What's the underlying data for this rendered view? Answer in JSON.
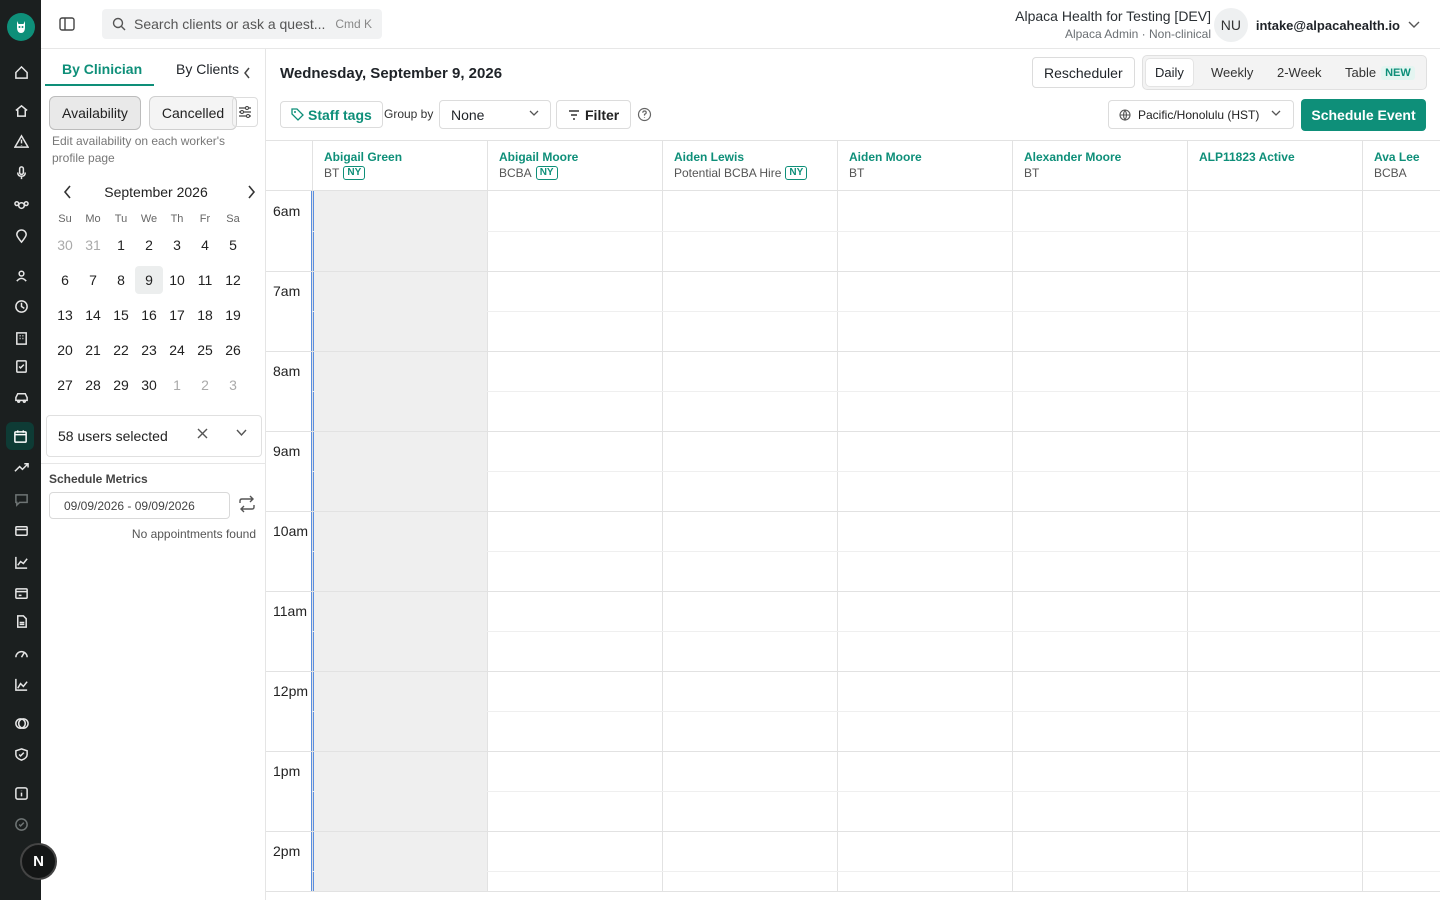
{
  "search": {
    "placeholder": "Search clients or ask a quest...",
    "shortcut": "Cmd K"
  },
  "org": {
    "name": "Alpaca Health for Testing [DEV]",
    "role": "Alpaca Admin · Non-clinical"
  },
  "user": {
    "initials": "NU",
    "email": "intake@alpacahealth.io"
  },
  "rail_badge": "N",
  "sidebar": {
    "tabs": [
      "By Clinician",
      "By Clients"
    ],
    "buttons": [
      "Availability",
      "Cancelled"
    ],
    "hint": "Edit availability on each worker's profile page",
    "calendar": {
      "month": "September 2026",
      "dow": [
        "Su",
        "Mo",
        "Tu",
        "We",
        "Th",
        "Fr",
        "Sa"
      ],
      "days": [
        {
          "d": "30",
          "out": true
        },
        {
          "d": "31",
          "out": true
        },
        {
          "d": "1"
        },
        {
          "d": "2"
        },
        {
          "d": "3"
        },
        {
          "d": "4"
        },
        {
          "d": "5"
        },
        {
          "d": "6"
        },
        {
          "d": "7"
        },
        {
          "d": "8"
        },
        {
          "d": "9",
          "sel": true
        },
        {
          "d": "10"
        },
        {
          "d": "11"
        },
        {
          "d": "12"
        },
        {
          "d": "13"
        },
        {
          "d": "14"
        },
        {
          "d": "15"
        },
        {
          "d": "16"
        },
        {
          "d": "17"
        },
        {
          "d": "18"
        },
        {
          "d": "19"
        },
        {
          "d": "20"
        },
        {
          "d": "21"
        },
        {
          "d": "22"
        },
        {
          "d": "23"
        },
        {
          "d": "24"
        },
        {
          "d": "25"
        },
        {
          "d": "26"
        },
        {
          "d": "27"
        },
        {
          "d": "28"
        },
        {
          "d": "29"
        },
        {
          "d": "30"
        },
        {
          "d": "1",
          "out": true
        },
        {
          "d": "2",
          "out": true
        },
        {
          "d": "3",
          "out": true
        }
      ]
    },
    "users_selected": "58 users selected",
    "metrics_title": "Schedule Metrics",
    "range": "09/09/2026 - 09/09/2026",
    "no_appointments": "No appointments found"
  },
  "main": {
    "date_title": "Wednesday, September 9, 2026",
    "rescheduler": "Rescheduler",
    "views": [
      "Daily",
      "Weekly",
      "2-Week",
      "Table"
    ],
    "active_view": "Daily",
    "new_badge": "NEW",
    "staff_tags": "Staff tags",
    "group_by_label": "Group by",
    "group_by_value": "None",
    "filter": "Filter",
    "timezone": "Pacific/Honolulu (HST)",
    "schedule_event": "Schedule Event",
    "accent": "#0e8f79",
    "columns": [
      {
        "name": "Abigail Green",
        "role": "BT",
        "tag": "NY"
      },
      {
        "name": "Abigail Moore",
        "role": "BCBA",
        "tag": "NY"
      },
      {
        "name": "Aiden Lewis",
        "role": "Potential BCBA Hire",
        "tag": "NY"
      },
      {
        "name": "Aiden Moore",
        "role": "BT",
        "tag": ""
      },
      {
        "name": "Alexander Moore",
        "role": "BT",
        "tag": ""
      },
      {
        "name": "ALP11823 Active",
        "role": "",
        "tag": ""
      },
      {
        "name": "Ava Lee",
        "role": "BCBA",
        "tag": ""
      }
    ],
    "hours": [
      "6am",
      "7am",
      "8am",
      "9am",
      "10am",
      "11am",
      "12pm",
      "1pm",
      "2pm"
    ]
  }
}
